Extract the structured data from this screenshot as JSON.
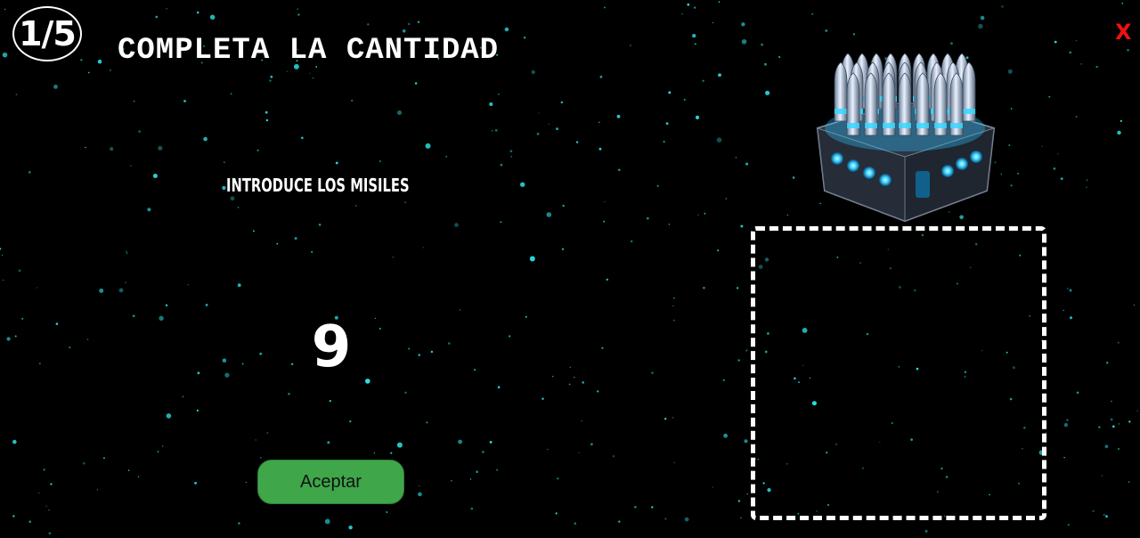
{
  "header": {
    "progress": "1/5",
    "title": "COMPLETA LA CANTIDAD",
    "close_label": "X"
  },
  "task": {
    "instruction": "INTRODUCE LOS MISILES",
    "quantity": "9"
  },
  "actions": {
    "accept_label": "Aceptar"
  },
  "items": {
    "draggable": "missile-crate-icon"
  },
  "colors": {
    "background": "#000000",
    "star": "#29e0e6",
    "accent_button": "#3fa64a",
    "close": "#ee1111"
  }
}
